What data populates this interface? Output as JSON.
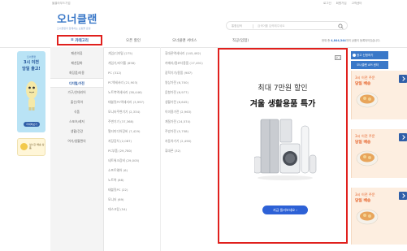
{
  "top": {
    "bookmark": "올클라우드기업",
    "links": [
      "로그인",
      "회원가입",
      "고객센터"
    ]
  },
  "logo": {
    "name": "오너클랜",
    "slogan": "오너클랜과 함께하는 쇼핑몰 운영"
  },
  "search": {
    "category": "통합검색",
    "placeholder": "검색어를 입력해주세요"
  },
  "nav": {
    "category_label": "카테고리",
    "items": [
      "오픈 할인",
      "오너클랜 서비스",
      "직공(입점)"
    ],
    "info_prefix": "현재 총",
    "info_count": "4,844,344",
    "info_suffix": "개의 상품이 등록되어있습니다."
  },
  "left_banner": {
    "t1": "오너클랜",
    "t2a": "3시 이전",
    "t2b": "당일 출고!",
    "button": "자세히보기"
  },
  "left_banner2": {
    "text": "실시간 배송 상품"
  },
  "menu": {
    "col1": [
      "패션의류",
      "패션잡화",
      "화장품/미용",
      "디지털/가전",
      "가구/인테리어",
      "출산/육아",
      "식품",
      "스포츠/레저",
      "생활/건강",
      "여가/생활편의"
    ],
    "active_index": 3,
    "col2": [
      "게임/디지털 (275)",
      "게임기/타이틀 (858)",
      "PC (312)",
      "PC액세서리 (21,903)",
      "노트북액세서리 (38,446)",
      "태블릿PC액세서리 (3,997)",
      "모니터주변기기 (2,334)",
      "주변기기 (37,368)",
      "멀티미디어장비 (7,429)",
      "저장장치 (2,087)",
      "PC부품 (29,780)",
      "네트워크장비 (29,005)",
      "소프트웨어 (6)",
      "노트북 (88)",
      "태블릿PC (22)",
      "모니터 (69)",
      "데스크탑 (54)"
    ],
    "col3": [
      "휴대폰액세서리 (145,492)",
      "카메라/캠코더용품 (17,491)",
      "광학기기/용품 (987)",
      "영상가전 (6,700)",
      "음향가전 (6,977)",
      "생활가전 (6,645)",
      "이미용가전 (2,963)",
      "계절가전 (24,574)",
      "주방가전 (5,758)",
      "자동차기기 (2,490)",
      "휴대폰 (32)"
    ]
  },
  "ad": {
    "badge": "광고",
    "headline1": "최대 7만원 할인",
    "headline2": "겨울 생활용품 특가",
    "cta": "지금 둘러보세요"
  },
  "right": {
    "btn1": "광고 신청하기",
    "btn2": "오너클랜 API 센터",
    "promo_line1": "3시 이전 주문",
    "promo_line2": "당일 배송"
  },
  "colors": {
    "brand_blue": "#2f5fa8",
    "highlight_red": "#e0201d",
    "promo_orange": "#e55d22"
  }
}
